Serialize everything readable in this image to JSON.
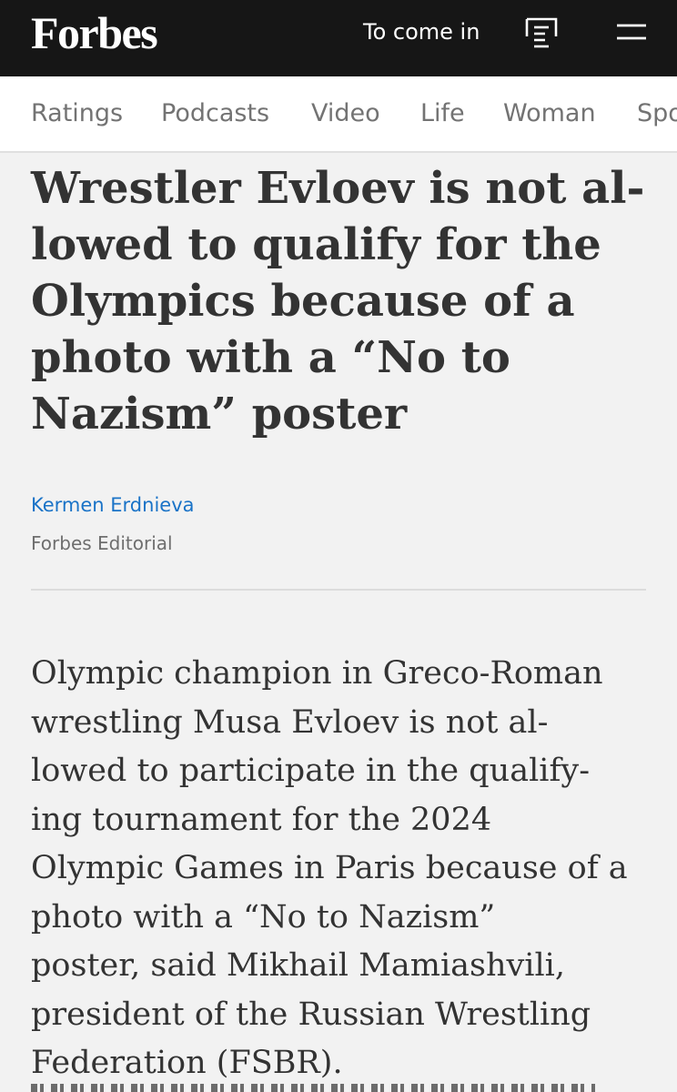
{
  "header": {
    "logo": "Forbes",
    "login_label": "To come in",
    "reader_icon": "reader-list-icon",
    "menu_icon": "hamburger-menu-icon"
  },
  "nav": {
    "items": [
      "Ratings",
      "Podcasts",
      "Video",
      "Life",
      "Woman",
      "Sports"
    ]
  },
  "article": {
    "headline": "Wrestler Evloev is not al-\nlowed to qualify for the\nOlympics because of a\nphoto with a “No to\nNazism” poster",
    "author": "Kermen Erdnieva",
    "byline_sub": "Forbes Editorial",
    "lead": "Olympic champion in Greco-Roman\nwrestling Musa Evloev is not al-\nlowed to participate in the qualify-\ning tournament for the 2024\nOlympic Games in Paris because of a\nphoto with a “No to Nazism”\nposter, said Mikhail Mamiashvili,\npresident of the Russian Wrestling\nFederation (FSBR)."
  },
  "colors": {
    "topbar": "#161616",
    "background": "#f2f2f2",
    "author_link": "#1a73c7",
    "text": "#333333",
    "nav_text": "#737373"
  }
}
